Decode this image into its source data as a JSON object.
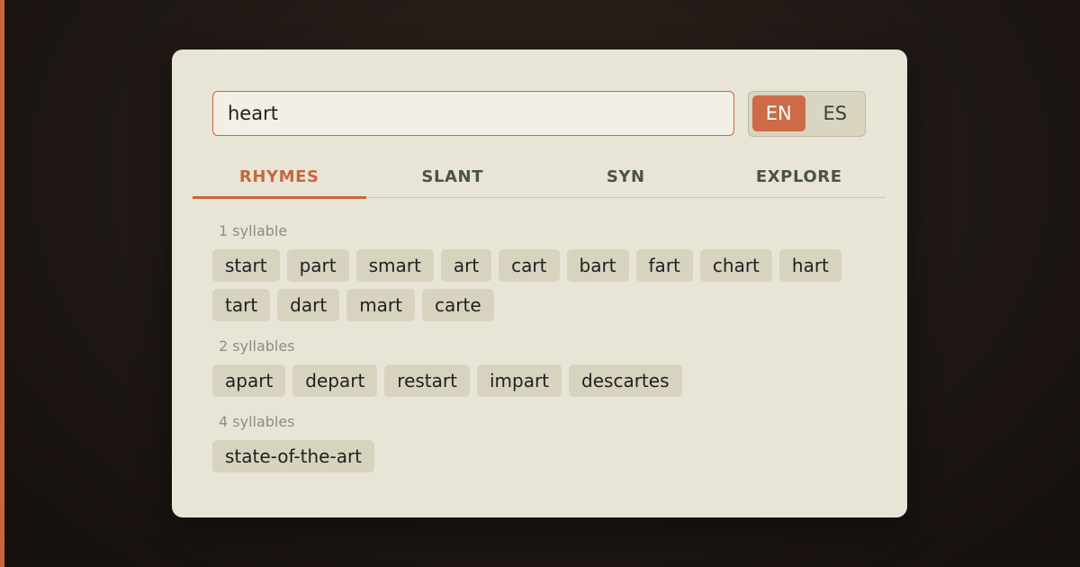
{
  "search": {
    "value": "heart"
  },
  "language": {
    "options": [
      "EN",
      "ES"
    ],
    "selected": "EN"
  },
  "tabs": [
    {
      "label": "RHYMES",
      "active": true
    },
    {
      "label": "SLANT",
      "active": false
    },
    {
      "label": "SYN",
      "active": false
    },
    {
      "label": "EXPLORE",
      "active": false
    }
  ],
  "groups": [
    {
      "label": "1 syllable",
      "words": [
        "start",
        "part",
        "smart",
        "art",
        "cart",
        "bart",
        "fart",
        "chart",
        "hart",
        "tart",
        "dart",
        "mart",
        "carte"
      ]
    },
    {
      "label": "2 syllables",
      "words": [
        "apart",
        "depart",
        "restart",
        "impart",
        "descartes"
      ]
    },
    {
      "label": "4 syllables",
      "words": [
        "state-of-the-art"
      ]
    }
  ],
  "colors": {
    "accent": "#c8663f",
    "card": "#e9e5d6",
    "chip": "#d8d3bf"
  }
}
